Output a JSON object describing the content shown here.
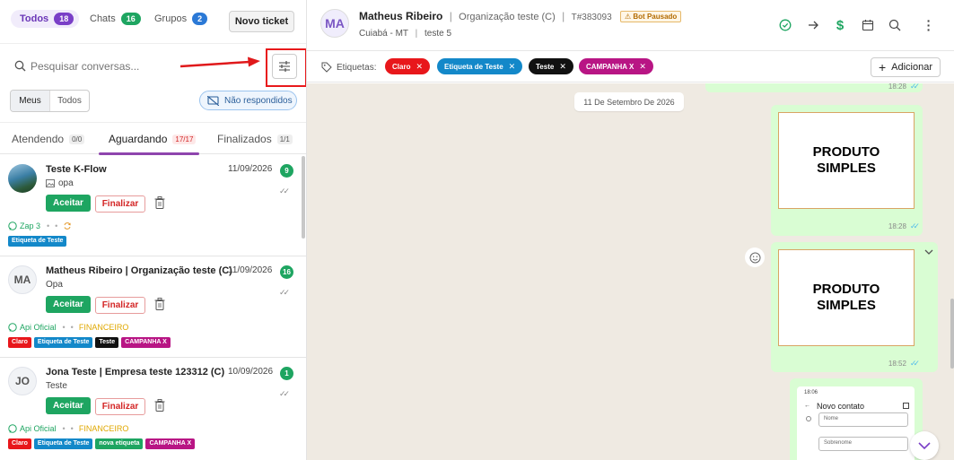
{
  "tabs": [
    {
      "label": "Todos",
      "count": "18",
      "color": "#7a3fc7"
    },
    {
      "label": "Chats",
      "count": "16",
      "color": "#1ea561"
    },
    {
      "label": "Grupos",
      "count": "2",
      "color": "#2b79d6"
    }
  ],
  "new_ticket_label": "Novo ticket",
  "search": {
    "placeholder": "Pesquisar conversas..."
  },
  "filter_icon": "sliders-icon",
  "owner_filter": {
    "mine": "Meus",
    "all": "Todos"
  },
  "unanswered_label": "Não respondidos",
  "status_tabs": [
    {
      "label": "Atendendo",
      "count": "0/0"
    },
    {
      "label": "Aguardando",
      "count": "17/17"
    },
    {
      "label": "Finalizados",
      "count": "1/1"
    }
  ],
  "tickets": [
    {
      "name": "Teste K-Flow",
      "date": "11/09/2026",
      "message": "opa",
      "message_icon": "image-icon",
      "unread": "9",
      "accept_label": "Aceitar",
      "finish_label": "Finalizar",
      "channel": "Zap 3",
      "queue": "",
      "tags": [
        {
          "label": "Etiqueta de Teste",
          "color": "#1388c9"
        }
      ]
    },
    {
      "name": "Matheus Ribeiro | Organização teste (C)",
      "avatar": "MA",
      "date": "11/09/2026",
      "message": "Opa",
      "unread": "16",
      "accept_label": "Aceitar",
      "finish_label": "Finalizar",
      "channel": "Api Oficial",
      "queue": "FINANCEIRO",
      "tags": [
        {
          "label": "Claro",
          "color": "#e8171b"
        },
        {
          "label": "Etiqueta de Teste",
          "color": "#1388c9"
        },
        {
          "label": "Teste",
          "color": "#111111"
        },
        {
          "label": "CAMPANHA X",
          "color": "#b81584"
        }
      ]
    },
    {
      "name": "Jona Teste | Empresa teste 123312 (C)",
      "avatar": "JO",
      "date": "10/09/2026",
      "message": "Teste",
      "unread": "1",
      "accept_label": "Aceitar",
      "finish_label": "Finalizar",
      "channel": "Api Oficial",
      "queue": "FINANCEIRO",
      "tags": [
        {
          "label": "Claro",
          "color": "#e8171b"
        },
        {
          "label": "Etiqueta de Teste",
          "color": "#1388c9"
        },
        {
          "label": "nova etiqueta",
          "color": "#1ea561"
        },
        {
          "label": "CAMPANHA X",
          "color": "#b81584"
        }
      ]
    }
  ],
  "contact": {
    "avatar": "MA",
    "name": "Matheus Ribeiro",
    "org": "Organização teste (C)",
    "ticket": "T#383093",
    "bot_status": "Bot Pausado",
    "city": "Cuiabá - MT",
    "queue": "teste 5"
  },
  "header_icons": [
    "check-circle-icon",
    "forward-arrow-icon",
    "dollar-icon",
    "calendar-icon",
    "search-icon",
    "more-vertical-icon"
  ],
  "labels_title": "Etiquetas:",
  "labels": [
    {
      "label": "Claro",
      "color": "#e8171b"
    },
    {
      "label": "Etiqueta de Teste",
      "color": "#1388c9"
    },
    {
      "label": "Teste",
      "color": "#111111"
    },
    {
      "label": "CAMPANHA X",
      "color": "#b81584"
    }
  ],
  "add_label": "Adicionar",
  "date_divider": "11 De Setembro De 2026",
  "messages": [
    {
      "time": "18:28"
    },
    {
      "image_text": "PRODUTO SIMPLES",
      "time": "18:28"
    },
    {
      "image_text": "PRODUTO SIMPLES",
      "time": "18:52"
    }
  ],
  "phone_screenshot": {
    "time": "18:06",
    "title": "Novo contato",
    "field1": "Nome",
    "field2": "Sobrenome"
  }
}
